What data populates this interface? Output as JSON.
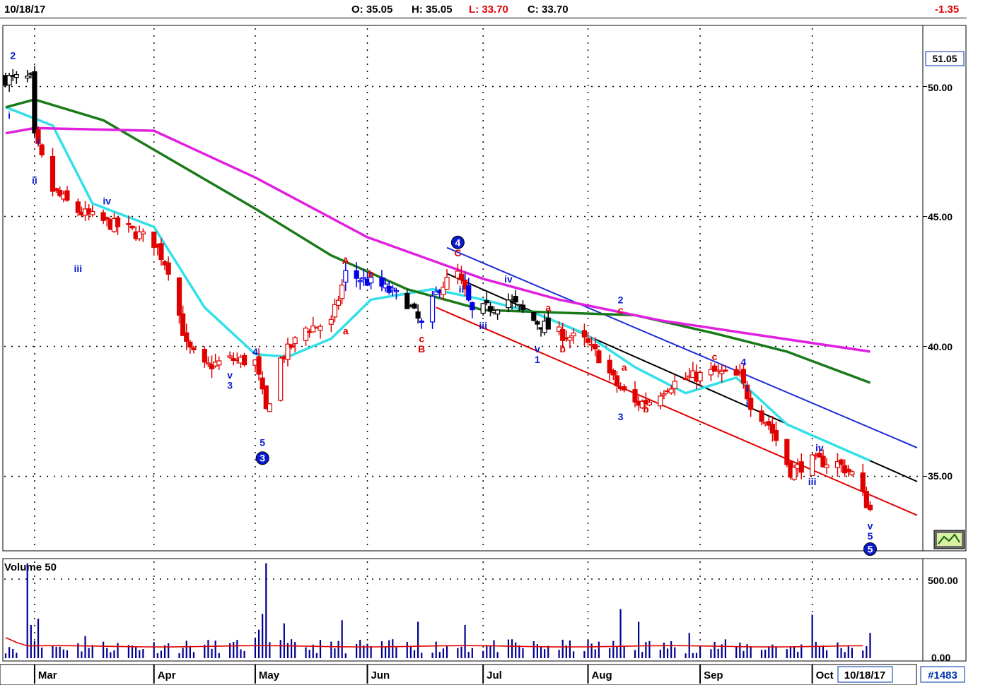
{
  "header": {
    "date": "10/18/17",
    "open": "O: 35.05",
    "high": "H: 35.05",
    "low": "L: 33.70",
    "close": "C: 33.70",
    "change": "-1.35",
    "colors": {
      "open": "#000000",
      "high": "#000000",
      "low": "#e00000",
      "close": "#000000",
      "change": "#e00000"
    }
  },
  "footer": {
    "months": [
      "Mar",
      "Apr",
      "May",
      "Jun",
      "Jul",
      "Aug",
      "Sep",
      "Oct"
    ],
    "cursor_date": "10/18/17",
    "bar_count": "#1483"
  },
  "volume_panel": {
    "title": "Volume 50",
    "ticks": [
      "500.00",
      "0.00"
    ]
  },
  "price_panel": {
    "last_price_label": "51.05",
    "ticks": [
      "50.00",
      "45.00",
      "40.00",
      "35.00"
    ]
  },
  "colors": {
    "up_bar": "#e00000",
    "blue_bar": "#0000e6",
    "black_bar": "#000000",
    "ma_fast": "#33e0e8",
    "ma_mid": "#1a7a1a",
    "ma_slow": "#e020e0",
    "channel_blue": "#1a2ad8",
    "channel_black": "#000000",
    "channel_red": "#e00000",
    "volume": "#000090",
    "volume_avg": "#e00000"
  },
  "chart_data": {
    "type": "candlestick",
    "x_range": [
      "2017-02-21",
      "2017-10-18"
    ],
    "ylim": [
      32.2,
      51.6
    ],
    "y_ticks": [
      35,
      40,
      45,
      50
    ],
    "grid": "dotted",
    "legend": "none",
    "price_path": [
      [
        "2017-02-21",
        50.3
      ],
      [
        "2017-02-28",
        50.3
      ],
      [
        "2017-03-01",
        48.0
      ],
      [
        "2017-03-06",
        46.0
      ],
      [
        "2017-03-13",
        45.2
      ],
      [
        "2017-03-20",
        44.8
      ],
      [
        "2017-03-27",
        44.5
      ],
      [
        "2017-04-03",
        44.0
      ],
      [
        "2017-04-07",
        43.0
      ],
      [
        "2017-04-12",
        40.0
      ],
      [
        "2017-04-17",
        39.2
      ],
      [
        "2017-04-24",
        39.5
      ],
      [
        "2017-05-01",
        39.4
      ],
      [
        "2017-05-04",
        37.5
      ],
      [
        "2017-05-08",
        39.5
      ],
      [
        "2017-05-15",
        40.7
      ],
      [
        "2017-05-22",
        40.9
      ],
      [
        "2017-05-26",
        42.8
      ],
      [
        "2017-06-05",
        42.3
      ],
      [
        "2017-06-12",
        41.7
      ],
      [
        "2017-06-16",
        40.8
      ],
      [
        "2017-06-21",
        42.3
      ],
      [
        "2017-06-26",
        42.8
      ],
      [
        "2017-06-30",
        41.3
      ],
      [
        "2017-07-05",
        41.5
      ],
      [
        "2017-07-10",
        41.8
      ],
      [
        "2017-07-17",
        41.0
      ],
      [
        "2017-07-24",
        40.5
      ],
      [
        "2017-07-31",
        40.2
      ],
      [
        "2017-08-04",
        39.6
      ],
      [
        "2017-08-09",
        38.5
      ],
      [
        "2017-08-14",
        37.8
      ],
      [
        "2017-08-18",
        37.9
      ],
      [
        "2017-08-23",
        38.5
      ],
      [
        "2017-08-29",
        38.8
      ],
      [
        "2017-09-05",
        39.0
      ],
      [
        "2017-09-12",
        38.8
      ],
      [
        "2017-09-15",
        37.8
      ],
      [
        "2017-09-20",
        37.0
      ],
      [
        "2017-09-26",
        35.2
      ],
      [
        "2017-10-02",
        35.6
      ],
      [
        "2017-10-09",
        35.5
      ],
      [
        "2017-10-13",
        35.1
      ],
      [
        "2017-10-18",
        33.7
      ]
    ],
    "moving_averages": [
      {
        "color": "cyan",
        "points": [
          [
            "2017-02-21",
            49.2
          ],
          [
            "2017-03-06",
            48.5
          ],
          [
            "2017-03-17",
            45.5
          ],
          [
            "2017-04-03",
            44.6
          ],
          [
            "2017-04-17",
            41.5
          ],
          [
            "2017-05-01",
            39.7
          ],
          [
            "2017-05-10",
            39.6
          ],
          [
            "2017-05-22",
            40.3
          ],
          [
            "2017-06-02",
            41.8
          ],
          [
            "2017-06-19",
            42.2
          ],
          [
            "2017-07-03",
            41.8
          ],
          [
            "2017-07-17",
            41.3
          ],
          [
            "2017-07-31",
            40.5
          ],
          [
            "2017-08-14",
            39.2
          ],
          [
            "2017-08-28",
            38.2
          ],
          [
            "2017-09-11",
            38.8
          ],
          [
            "2017-09-25",
            37.0
          ],
          [
            "2017-10-18",
            35.6
          ]
        ]
      },
      {
        "color": "green",
        "points": [
          [
            "2017-02-21",
            49.2
          ],
          [
            "2017-03-01",
            49.5
          ],
          [
            "2017-03-20",
            48.7
          ],
          [
            "2017-04-10",
            47.0
          ],
          [
            "2017-05-01",
            45.3
          ],
          [
            "2017-05-22",
            43.5
          ],
          [
            "2017-06-12",
            42.2
          ],
          [
            "2017-07-03",
            41.4
          ],
          [
            "2017-07-24",
            41.3
          ],
          [
            "2017-08-14",
            41.2
          ],
          [
            "2017-09-05",
            40.5
          ],
          [
            "2017-09-25",
            39.8
          ],
          [
            "2017-10-18",
            38.6
          ]
        ]
      },
      {
        "color": "magenta",
        "points": [
          [
            "2017-02-21",
            48.2
          ],
          [
            "2017-03-01",
            48.4
          ],
          [
            "2017-04-03",
            48.3
          ],
          [
            "2017-05-01",
            46.5
          ],
          [
            "2017-06-01",
            44.2
          ],
          [
            "2017-07-03",
            42.6
          ],
          [
            "2017-07-24",
            41.8
          ],
          [
            "2017-08-21",
            41.0
          ],
          [
            "2017-09-14",
            40.5
          ],
          [
            "2017-10-18",
            39.8
          ]
        ]
      }
    ],
    "trend_lines": [
      {
        "color": "blue",
        "from": [
          "2017-06-23",
          43.8
        ],
        "to": [
          "2017-10-31",
          36.1
        ]
      },
      {
        "color": "black",
        "from": [
          "2017-06-23",
          42.8
        ],
        "to": [
          "2017-10-31",
          34.8
        ]
      },
      {
        "color": "red",
        "from": [
          "2017-06-20",
          41.5
        ],
        "to": [
          "2017-10-31",
          33.5
        ]
      }
    ],
    "wave_labels": [
      {
        "text": "2",
        "date": "2017-02-23",
        "price": 51.2,
        "color": "blue"
      },
      {
        "text": "i",
        "date": "2017-02-22",
        "price": 48.9,
        "color": "blue"
      },
      {
        "text": "i",
        "date": "2017-03-02",
        "price": 47.9,
        "color": "blue"
      },
      {
        "text": "ii",
        "date": "2017-03-01",
        "price": 46.4,
        "color": "blue"
      },
      {
        "text": "iii",
        "date": "2017-03-13",
        "price": 43.0,
        "color": "blue"
      },
      {
        "text": "iv",
        "date": "2017-03-21",
        "price": 45.6,
        "color": "blue"
      },
      {
        "text": "4",
        "date": "2017-05-01",
        "price": 39.8,
        "color": "blue"
      },
      {
        "text": "v",
        "date": "2017-04-24",
        "price": 38.9,
        "color": "blue"
      },
      {
        "text": "3",
        "date": "2017-04-24",
        "price": 38.5,
        "color": "blue"
      },
      {
        "text": "5",
        "date": "2017-05-03",
        "price": 36.3,
        "color": "blue"
      },
      {
        "text": "3",
        "date": "2017-05-03",
        "price": 35.7,
        "color": "blue",
        "circled": true
      },
      {
        "text": "A",
        "date": "2017-05-26",
        "price": 43.3,
        "color": "red"
      },
      {
        "text": "b",
        "date": "2017-06-02",
        "price": 42.8,
        "color": "red"
      },
      {
        "text": "a",
        "date": "2017-05-26",
        "price": 40.6,
        "color": "red"
      },
      {
        "text": "c",
        "date": "2017-06-16",
        "price": 40.3,
        "color": "red"
      },
      {
        "text": "B",
        "date": "2017-06-16",
        "price": 39.9,
        "color": "red"
      },
      {
        "text": "4",
        "date": "2017-06-26",
        "price": 44.0,
        "color": "blue",
        "circled": true
      },
      {
        "text": "C",
        "date": "2017-06-26",
        "price": 43.6,
        "color": "red"
      },
      {
        "text": "i",
        "date": "2017-06-28",
        "price": 42.7,
        "color": "blue"
      },
      {
        "text": "ii",
        "date": "2017-06-27",
        "price": 42.2,
        "color": "blue"
      },
      {
        "text": "iii",
        "date": "2017-07-03",
        "price": 40.8,
        "color": "blue"
      },
      {
        "text": "iv",
        "date": "2017-07-10",
        "price": 42.6,
        "color": "blue"
      },
      {
        "text": "a",
        "date": "2017-07-21",
        "price": 41.5,
        "color": "red"
      },
      {
        "text": "v",
        "date": "2017-07-18",
        "price": 39.9,
        "color": "blue"
      },
      {
        "text": "1",
        "date": "2017-07-18",
        "price": 39.5,
        "color": "blue"
      },
      {
        "text": "b",
        "date": "2017-07-25",
        "price": 39.9,
        "color": "red"
      },
      {
        "text": "2",
        "date": "2017-08-10",
        "price": 41.8,
        "color": "blue"
      },
      {
        "text": "c",
        "date": "2017-08-10",
        "price": 41.4,
        "color": "red"
      },
      {
        "text": "a",
        "date": "2017-08-11",
        "price": 39.2,
        "color": "red"
      },
      {
        "text": "3",
        "date": "2017-08-10",
        "price": 37.3,
        "color": "blue"
      },
      {
        "text": "b",
        "date": "2017-08-17",
        "price": 37.6,
        "color": "red"
      },
      {
        "text": "c",
        "date": "2017-09-05",
        "price": 39.6,
        "color": "red"
      },
      {
        "text": "4",
        "date": "2017-09-13",
        "price": 39.4,
        "color": "blue"
      },
      {
        "text": "i",
        "date": "2017-09-14",
        "price": 38.4,
        "color": "blue"
      },
      {
        "text": "i",
        "date": "2017-09-14",
        "price": 37.8,
        "color": "blue"
      },
      {
        "text": "iii",
        "date": "2017-10-02",
        "price": 34.8,
        "color": "blue"
      },
      {
        "text": "iv",
        "date": "2017-10-04",
        "price": 36.1,
        "color": "blue"
      },
      {
        "text": "v",
        "date": "2017-10-18",
        "price": 33.1,
        "color": "blue"
      },
      {
        "text": "5",
        "date": "2017-10-18",
        "price": 32.7,
        "color": "blue"
      },
      {
        "text": "5",
        "date": "2017-10-18",
        "price": 32.2,
        "color": "blue",
        "circled": true
      }
    ],
    "volume": {
      "title": "Volume 50",
      "ylim": [
        0,
        600
      ],
      "y_ticks": [
        0,
        500
      ],
      "average_level": 75,
      "spikes": [
        [
          "2017-02-27",
          600
        ],
        [
          "2017-02-28",
          210
        ],
        [
          "2017-03-02",
          250
        ],
        [
          "2017-03-15",
          140
        ],
        [
          "2017-05-01",
          130
        ],
        [
          "2017-05-02",
          180
        ],
        [
          "2017-05-03",
          280
        ],
        [
          "2017-05-04",
          600
        ],
        [
          "2017-05-09",
          220
        ],
        [
          "2017-05-25",
          240
        ],
        [
          "2017-06-15",
          230
        ],
        [
          "2017-06-28",
          210
        ],
        [
          "2017-08-10",
          310
        ],
        [
          "2017-08-15",
          230
        ],
        [
          "2017-08-29",
          160
        ],
        [
          "2017-10-02",
          275
        ],
        [
          "2017-10-18",
          160
        ]
      ]
    }
  }
}
